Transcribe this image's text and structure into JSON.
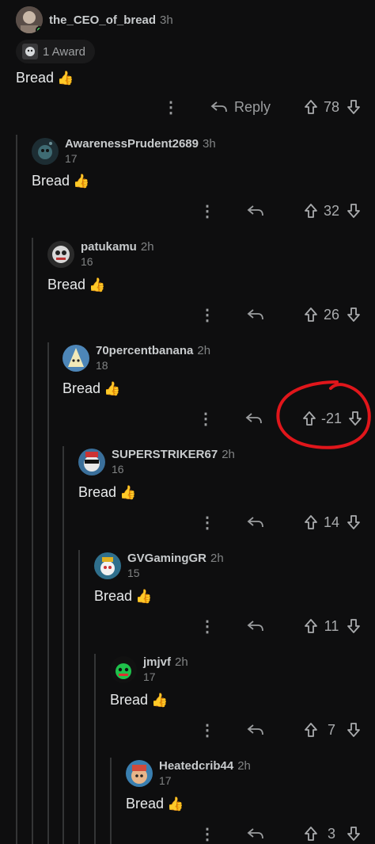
{
  "comments": [
    {
      "author": "the_CEO_of_bread",
      "age": "3h",
      "score_line": "",
      "body": "Bread",
      "votes": "78",
      "reply_label": "Reply"
    },
    {
      "author": "AwarenessPrudent2689",
      "age": "3h",
      "score_line": "17",
      "body": "Bread",
      "votes": "32"
    },
    {
      "author": "patukamu",
      "age": "2h",
      "score_line": "16",
      "body": "Bread",
      "votes": "26"
    },
    {
      "author": "70percentbanana",
      "age": "2h",
      "score_line": "18",
      "body": "Bread",
      "votes": "-21"
    },
    {
      "author": "SUPERSTRIKER67",
      "age": "2h",
      "score_line": "16",
      "body": "Bread",
      "votes": "14"
    },
    {
      "author": "GVGamingGR",
      "age": "2h",
      "score_line": "15",
      "body": "Bread",
      "votes": "11"
    },
    {
      "author": "jmjvf",
      "age": "2h",
      "score_line": "17",
      "body": "Bread",
      "votes": "7"
    },
    {
      "author": "Heatedcrib44",
      "age": "2h",
      "score_line": "17",
      "body": "Bread",
      "votes": "3"
    }
  ],
  "award": {
    "label": "1 Award"
  },
  "emoji": "👍",
  "colors": {
    "background": "#0e0e0f",
    "annotation": "#e0161b",
    "online": "#46d160"
  }
}
